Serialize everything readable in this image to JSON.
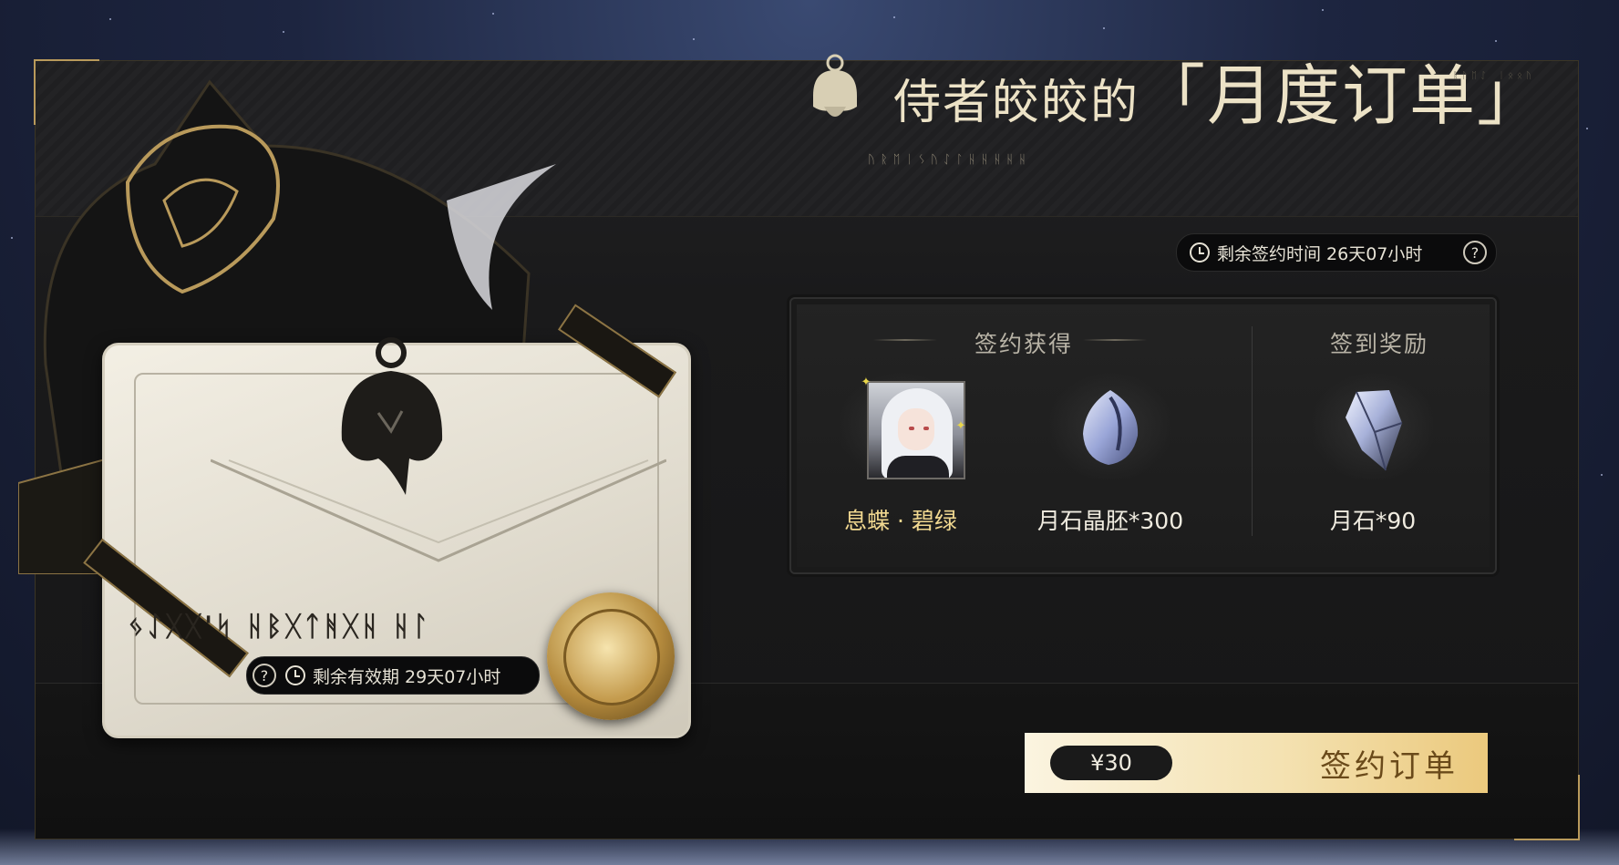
{
  "header": {
    "title_prefix": "侍者皎皎的",
    "title_main": "「月度订单」",
    "rune_subtitle": "ᚢᚱᛖᛁᛊᚢᛇᛚᚺᚺᚺᚺᚺ",
    "rune_corner": "ᚱᚢᛖᛇ ᛁᛟᛟᚢ",
    "emblem_icon": "maid-silhouette-icon"
  },
  "sign_timer": {
    "text": "剩余签约时间 26天07小时",
    "help": "?"
  },
  "rewards": {
    "sign_section_title": "签约获得",
    "checkin_section_title": "签到奖励",
    "items": [
      {
        "name": "息蝶 · 碧绿",
        "icon": "character-avatar"
      },
      {
        "name": "月石晶胚*300",
        "icon": "moonstone-embryo-icon"
      },
      {
        "name": "月石*90",
        "icon": "moonstone-icon"
      }
    ]
  },
  "card": {
    "rune_title": "ᛃᛇᚷᚷ'ᛋ ᚺᛒᚷᛏᚻᚷᚺ ᚺᛚ",
    "valid_timer": "剩余有效期 29天07小时",
    "help": "?"
  },
  "purchase": {
    "price": "¥30",
    "label": "签约订单"
  },
  "colors": {
    "gold": "#b99a5b",
    "panel": "#1c1c1d",
    "button_gradient_end": "#ebc97d",
    "accent_text": "#f1d890"
  }
}
